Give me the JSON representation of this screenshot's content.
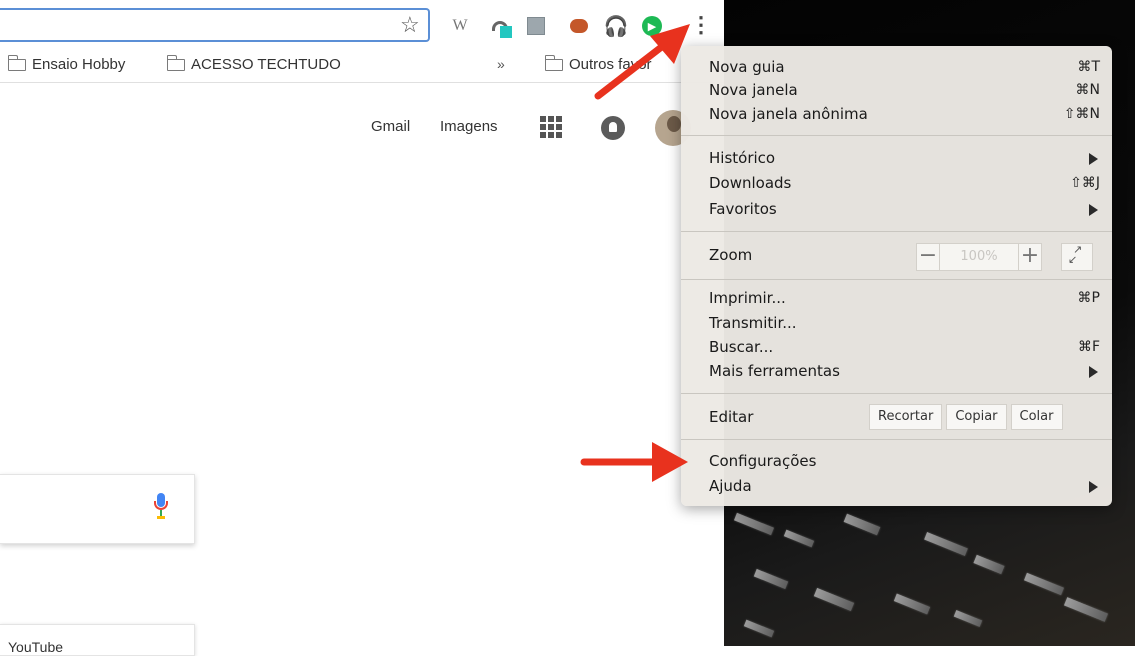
{
  "toolbar": {
    "ext_w": "W"
  },
  "bookmarks": [
    {
      "label": "Ensaio Hobby"
    },
    {
      "label": "ACESSO TECHTUDO"
    },
    {
      "label": "Outros favor"
    }
  ],
  "bookmarks_overflow": "»",
  "google": {
    "gmail": "Gmail",
    "imagens": "Imagens",
    "tile_label": "YouTube"
  },
  "menu": {
    "nova_guia": {
      "label": "Nova guia",
      "shortcut": "⌘T"
    },
    "nova_janela": {
      "label": "Nova janela",
      "shortcut": "⌘N"
    },
    "nova_janela_anonima": {
      "label": "Nova janela anônima",
      "shortcut": "⇧⌘N"
    },
    "historico": {
      "label": "Histórico"
    },
    "downloads": {
      "label": "Downloads",
      "shortcut": "⇧⌘J"
    },
    "favoritos": {
      "label": "Favoritos"
    },
    "zoom": {
      "label": "Zoom",
      "minus": "−",
      "value": "100%",
      "plus": "+"
    },
    "imprimir": {
      "label": "Imprimir...",
      "shortcut": "⌘P"
    },
    "transmitir": {
      "label": "Transmitir..."
    },
    "buscar": {
      "label": "Buscar...",
      "shortcut": "⌘F"
    },
    "mais_ferramentas": {
      "label": "Mais ferramentas"
    },
    "editar": {
      "label": "Editar",
      "recortar": "Recortar",
      "copiar": "Copiar",
      "colar": "Colar"
    },
    "configuracoes": {
      "label": "Configurações"
    },
    "ajuda": {
      "label": "Ajuda"
    }
  },
  "colors": {
    "annotation_arrow": "#e8321e",
    "omnibox_focus": "#5b8fd6"
  }
}
